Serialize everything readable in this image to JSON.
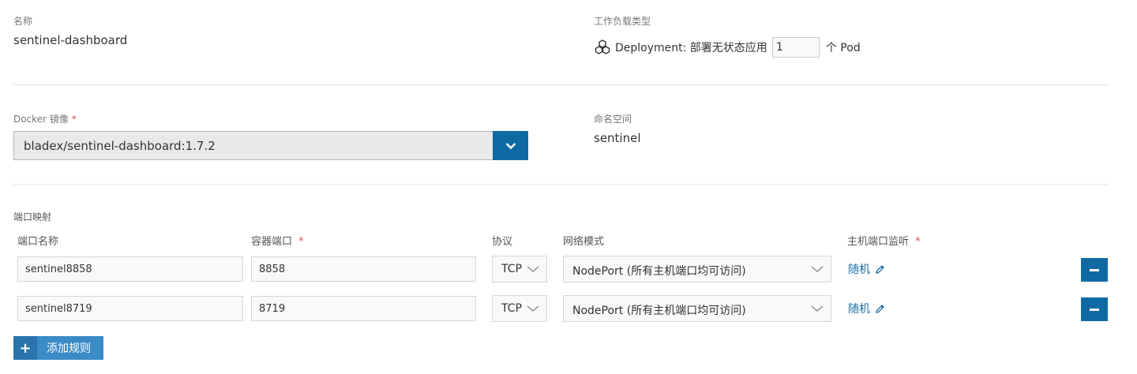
{
  "name_section": {
    "label": "名称",
    "value": "sentinel-dashboard"
  },
  "workload": {
    "label": "工作负载类型",
    "type_text": "Deployment: 部署无状态应用",
    "replicas": "1",
    "unit": "个 Pod"
  },
  "docker": {
    "label": "Docker 镜像",
    "required": "*",
    "image": "bladex/sentinel-dashboard:1.7.2"
  },
  "namespace": {
    "label": "命名空间",
    "value": "sentinel"
  },
  "ports": {
    "section_label": "端口映射",
    "headers": {
      "name": "端口名称",
      "container_port": "容器端口",
      "container_port_required": "*",
      "protocol": "协议",
      "network_mode": "网络模式",
      "host_port": "主机端口监听",
      "host_port_required": "*"
    },
    "rows": [
      {
        "name": "sentinel8858",
        "container_port": "8858",
        "protocol": "TCP",
        "network_mode": "NodePort (所有主机端口均可访问)",
        "host_port": "随机"
      },
      {
        "name": "sentinel8719",
        "container_port": "8719",
        "protocol": "TCP",
        "network_mode": "NodePort (所有主机端口均可访问)",
        "host_port": "随机"
      }
    ],
    "add_rule_label": "添加规则",
    "add_rule_icon": "plus-icon"
  },
  "colors": {
    "primary": "#0f6aa4",
    "link": "#1d6ca8",
    "required": "#d9534f"
  }
}
